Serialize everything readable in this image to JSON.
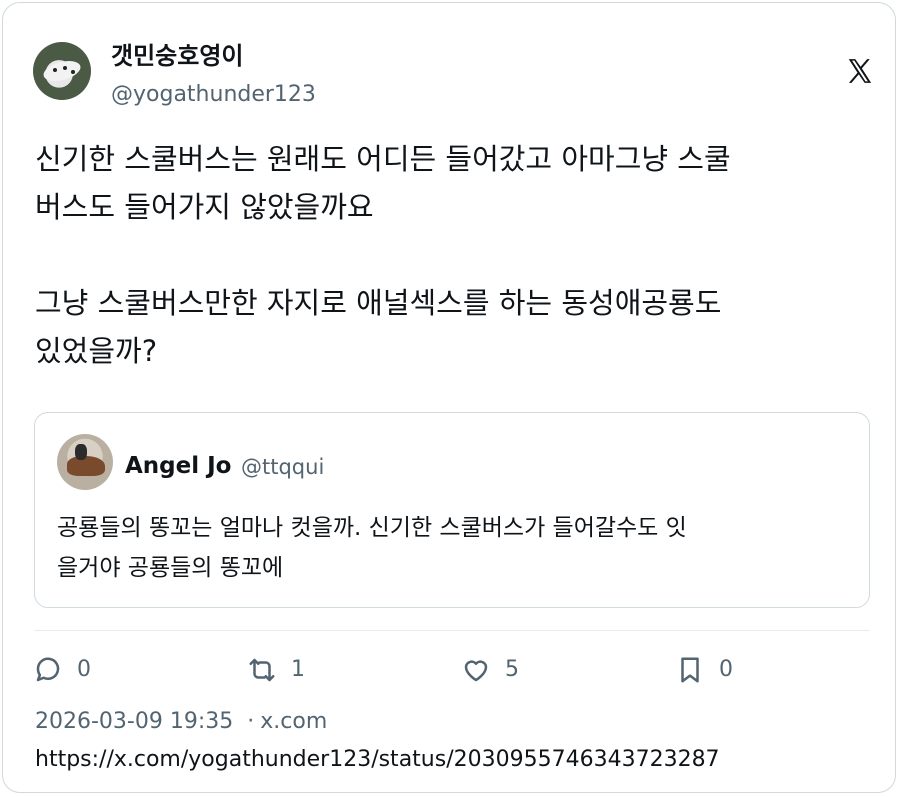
{
  "author": {
    "name": "갯민숭호영이",
    "handle": "@yogathunder123"
  },
  "tweet": {
    "text": "신기한 스쿨버스는 원래도 어디든 들어갔고 아마그냥 스쿨\n버스도 들어가지 않았을까요\n\n그냥 스쿨버스만한 자지로 애널섹스를 하는 동성애공룡도\n있었을까?"
  },
  "quoted": {
    "name": "Angel Jo",
    "handle": "@ttqqui",
    "text": "공룡들의 똥꼬는 얼마나 컷을까. 신기한 스쿨버스가 들어갈수도 잇\n을거야 공룡들의 똥꼬에"
  },
  "actions": {
    "replies": "0",
    "retweets": "1",
    "likes": "5",
    "bookmarks": "0"
  },
  "meta": {
    "timestamp": "2026-03-09 19:35",
    "separator": "·",
    "source": "x.com",
    "url": "https://x.com/yogathunder123/status/2030955746343723287"
  },
  "icons": {
    "logo": "x-logo-icon",
    "reply": "reply-icon",
    "retweet": "retweet-icon",
    "like": "heart-icon",
    "bookmark": "bookmark-icon"
  },
  "colors": {
    "text": "#0f1419",
    "secondary": "#536471",
    "border": "#cfd9de"
  }
}
